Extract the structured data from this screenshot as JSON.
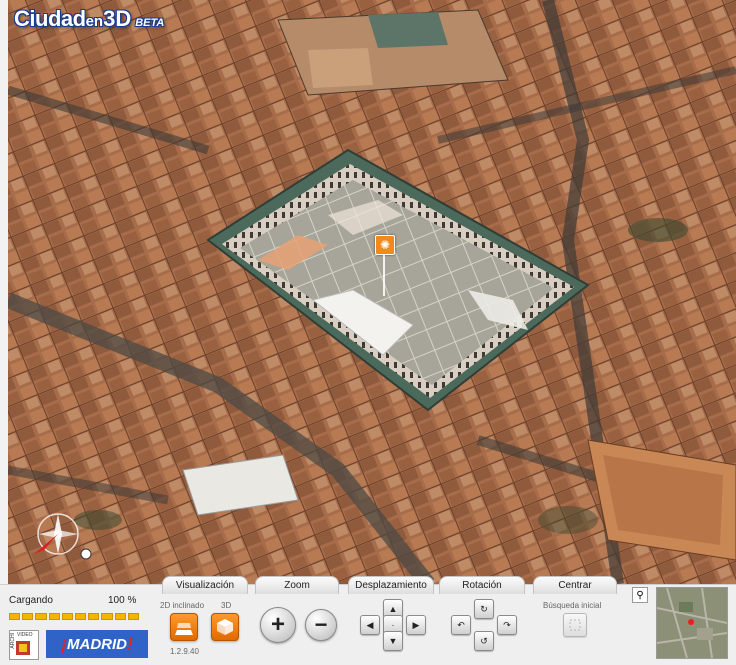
{
  "app": {
    "logo_ciudad": "Ciudad",
    "logo_en": "en",
    "logo_3d": "3D",
    "logo_beta": "BETA"
  },
  "tabs": {
    "visualizacion": "Visualización",
    "zoom": "Zoom",
    "desplazamiento": "Desplazamiento",
    "rotacion": "Rotación",
    "centrar": "Centrar"
  },
  "loading": {
    "label": "Cargando",
    "percent_text": "100 %",
    "progress": 1.0
  },
  "visualizacion": {
    "mode_2d_label": "2D inclinado",
    "mode_3d_label": "3D"
  },
  "version": "1.2.9.40",
  "centrar": {
    "busqueda_label": "Búsqueda inicial"
  },
  "branding": {
    "madrid_text": "MADRID",
    "madrid_open": "¡",
    "madrid_close": "!",
    "archivo_top": "VIDEO",
    "archivo_side": "ARCHI"
  },
  "icons": {
    "poi": "sun-marker-icon",
    "compass": "compass-icon",
    "search": "magnifier-icon"
  },
  "colors": {
    "accent_orange": "#f18a1a",
    "progress_yellow": "#f4b400",
    "madrid_blue": "#2f63c7"
  }
}
